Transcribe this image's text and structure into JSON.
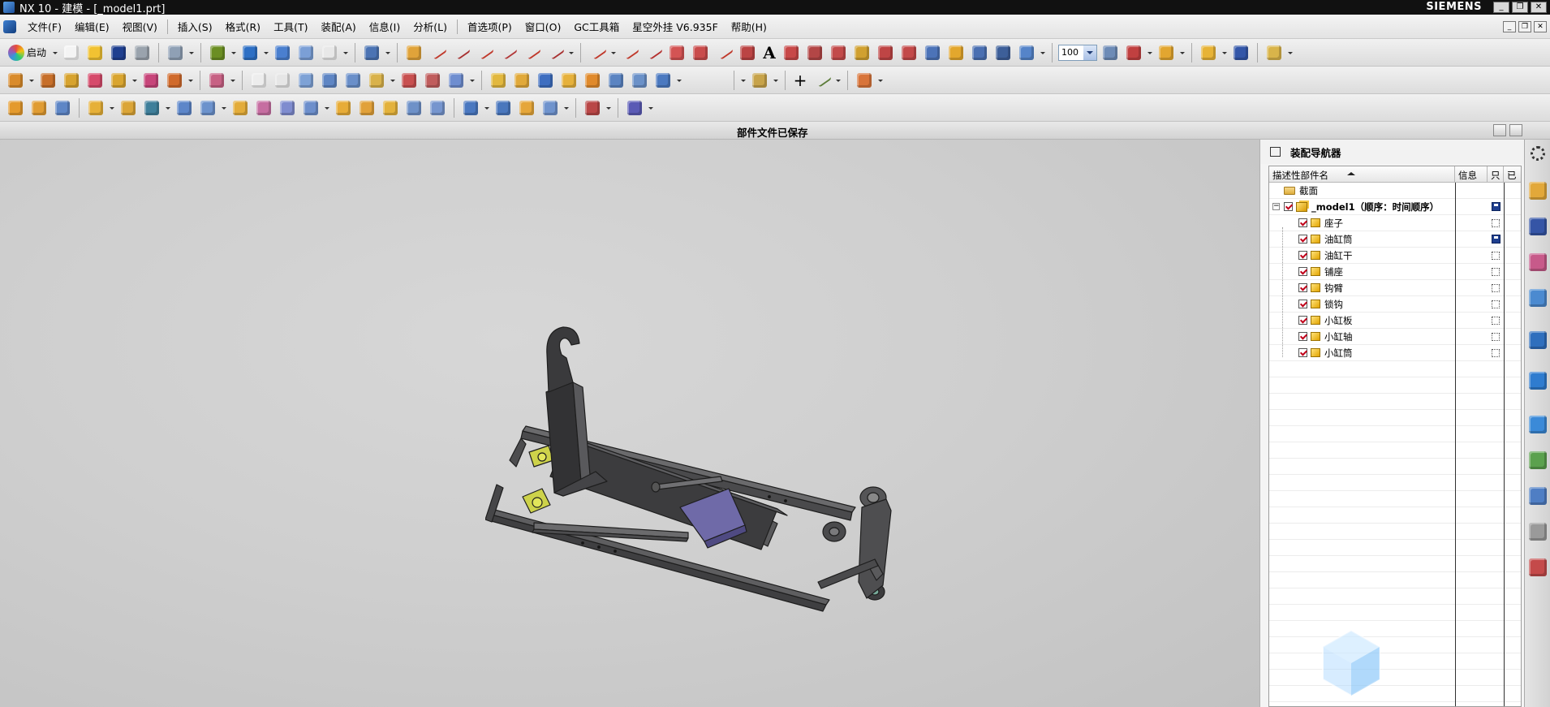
{
  "window": {
    "title": "NX 10 - 建模 - [_model1.prt]",
    "brand": "SIEMENS"
  },
  "menu": {
    "items": [
      "文件(F)",
      "编辑(E)",
      "视图(V)",
      "插入(S)",
      "格式(R)",
      "工具(T)",
      "装配(A)",
      "信息(I)",
      "分析(L)",
      "首选项(P)",
      "窗口(O)",
      "GC工具箱",
      "星空外挂 V6.935F",
      "帮助(H)"
    ]
  },
  "toolbar": {
    "start_label": "启动",
    "text_tool_label": "A",
    "zoom_value": "100"
  },
  "status": {
    "message": "部件文件已保存"
  },
  "navigator": {
    "title": "装配导航器",
    "columns": {
      "name": "描述性部件名",
      "info": "信息",
      "readonly": "只",
      "modified": "已"
    },
    "section_label": "截面",
    "root_label": "_model1（顺序：时间顺序）",
    "parts": [
      {
        "name": "座子",
        "saved": false
      },
      {
        "name": "油缸筒",
        "saved": true
      },
      {
        "name": "油缸干",
        "saved": false
      },
      {
        "name": "铺座",
        "saved": false
      },
      {
        "name": "钩臂",
        "saved": false
      },
      {
        "name": "锁钩",
        "saved": false
      },
      {
        "name": "小缸板",
        "saved": false
      },
      {
        "name": "小缸轴",
        "saved": false
      },
      {
        "name": "小缸筒",
        "saved": false
      }
    ]
  },
  "colors": {
    "accent": "#3b74c7",
    "check": "#c0001a",
    "part_yellow": "#e2a400",
    "model_dark": "#3c3c3e",
    "model_purple": "#6f6aa8",
    "model_yellow": "#cdd24a"
  }
}
